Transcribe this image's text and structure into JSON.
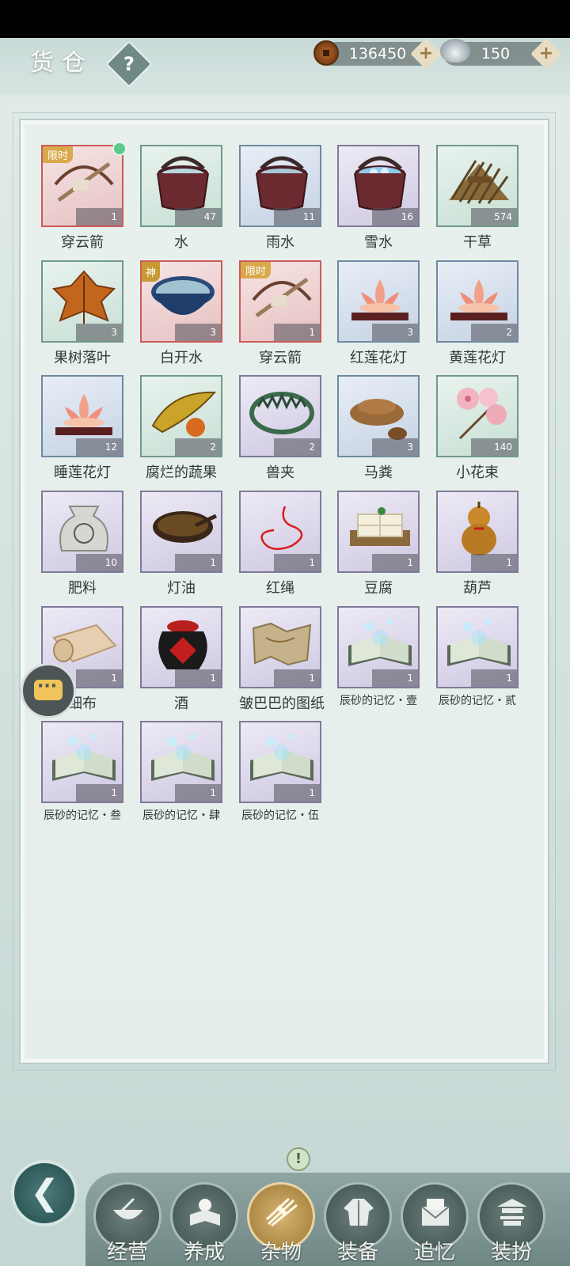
{
  "header": {
    "title": "货仓",
    "help_icon": "question-icon"
  },
  "currency": {
    "coins": "136450",
    "silver": "150"
  },
  "items": [
    {
      "name": "穿云箭",
      "count": "1",
      "badge": "限时",
      "rarity": "red",
      "dot": true,
      "icon": "crossbow-icon"
    },
    {
      "name": "水",
      "count": "47",
      "rarity": "green",
      "icon": "water-bucket-icon"
    },
    {
      "name": "雨水",
      "count": "11",
      "rarity": "blue",
      "icon": "rain-bucket-icon"
    },
    {
      "name": "雪水",
      "count": "16",
      "rarity": "purple",
      "icon": "snow-bucket-icon"
    },
    {
      "name": "干草",
      "count": "574",
      "rarity": "green",
      "icon": "hay-icon"
    },
    {
      "name": "果树落叶",
      "count": "3",
      "rarity": "green",
      "icon": "leaf-icon"
    },
    {
      "name": "白开水",
      "count": "3",
      "badge": "神",
      "rarity": "red",
      "icon": "bowl-water-icon"
    },
    {
      "name": "穿云箭",
      "count": "1",
      "badge": "限时",
      "rarity": "red",
      "icon": "crossbow-icon"
    },
    {
      "name": "红莲花灯",
      "count": "3",
      "rarity": "blue",
      "icon": "lotus-lamp-icon"
    },
    {
      "name": "黄莲花灯",
      "count": "2",
      "rarity": "blue",
      "icon": "lotus-lamp-icon"
    },
    {
      "name": "睡莲花灯",
      "count": "12",
      "rarity": "blue",
      "icon": "lotus-lamp-icon"
    },
    {
      "name": "腐烂的蔬果",
      "count": "2",
      "rarity": "green",
      "icon": "rotten-fruit-icon"
    },
    {
      "name": "兽夹",
      "count": "2",
      "rarity": "purple",
      "icon": "trap-icon"
    },
    {
      "name": "马粪",
      "count": "3",
      "rarity": "blue",
      "icon": "dung-icon"
    },
    {
      "name": "小花束",
      "count": "140",
      "rarity": "green",
      "icon": "flower-bouquet-icon"
    },
    {
      "name": "肥料",
      "count": "10",
      "rarity": "purple",
      "icon": "fertilizer-sack-icon"
    },
    {
      "name": "灯油",
      "count": "1",
      "rarity": "purple",
      "icon": "oil-bowl-icon"
    },
    {
      "name": "红绳",
      "count": "1",
      "rarity": "purple",
      "icon": "red-string-icon"
    },
    {
      "name": "豆腐",
      "count": "1",
      "rarity": "purple",
      "icon": "tofu-icon"
    },
    {
      "name": "葫芦",
      "count": "1",
      "rarity": "purple",
      "icon": "gourd-icon"
    },
    {
      "name": "细布",
      "count": "1",
      "rarity": "purple",
      "icon": "cloth-roll-icon"
    },
    {
      "name": "酒",
      "count": "1",
      "rarity": "purple",
      "icon": "wine-jar-icon"
    },
    {
      "name": "皱巴巴的图纸",
      "count": "1",
      "rarity": "purple",
      "icon": "map-icon"
    },
    {
      "name": "辰砂的记忆・壹",
      "count": "1",
      "rarity": "purple",
      "icon": "memory-book-icon"
    },
    {
      "name": "辰砂的记忆・贰",
      "count": "1",
      "rarity": "purple",
      "icon": "memory-book-icon"
    },
    {
      "name": "辰砂的记忆・叁",
      "count": "1",
      "rarity": "purple",
      "icon": "memory-book-icon"
    },
    {
      "name": "辰砂的记忆・肆",
      "count": "1",
      "rarity": "purple",
      "icon": "memory-book-icon"
    },
    {
      "name": "辰砂的记忆・伍",
      "count": "1",
      "rarity": "purple",
      "icon": "memory-book-icon"
    }
  ],
  "nav": [
    {
      "label": "经营",
      "icon": "bowl-icon",
      "active": false
    },
    {
      "label": "养成",
      "icon": "book-pearl-icon",
      "active": false
    },
    {
      "label": "杂物",
      "icon": "hay-bundle-icon",
      "active": true
    },
    {
      "label": "装备",
      "icon": "robe-icon",
      "active": false
    },
    {
      "label": "追忆",
      "icon": "letter-icon",
      "active": false
    },
    {
      "label": "装扮",
      "icon": "pavilion-icon",
      "active": false
    }
  ],
  "alert_badge": "!",
  "colors": {
    "active_nav": "#c9a45a",
    "badge": "#d9a84a",
    "count_bg": "#505a5a"
  }
}
